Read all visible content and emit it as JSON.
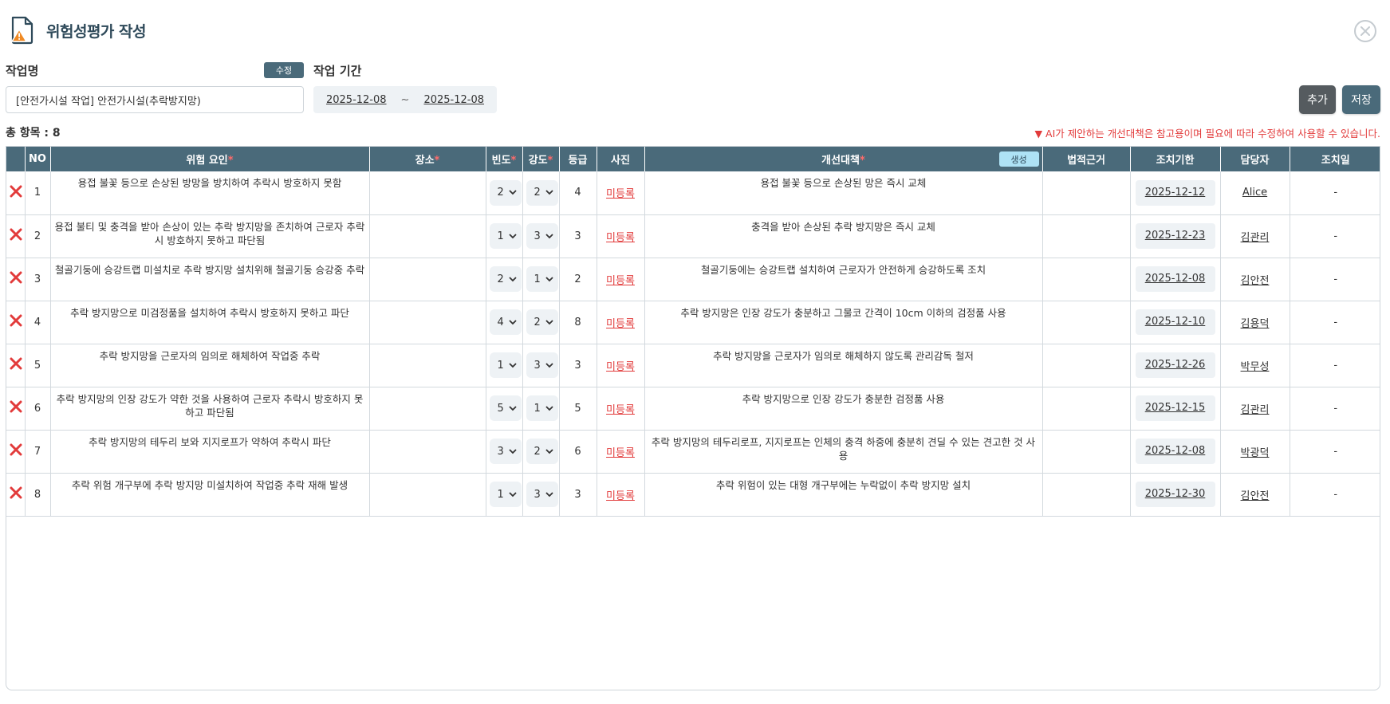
{
  "header": {
    "title": "위험성평가 작성"
  },
  "form": {
    "job_name_label": "작업명",
    "edit_label": "수정",
    "job_period_label": "작업 기간",
    "job_name_value": "[안전가시설 작업] 안전가시설(추락방지망)",
    "period_start": "2025-12-08",
    "period_sep": "~",
    "period_end": "2025-12-08"
  },
  "toolbar": {
    "add_label": "추가",
    "save_label": "저장"
  },
  "summary": {
    "total_text": "총 항목 : 8",
    "ai_note": "▼ AI가 제안하는 개선대책은 참고용이며 필요에 따라 수정하여 사용할 수 있습니다."
  },
  "table": {
    "headers": {
      "no": "NO",
      "hazard": "위험 요인",
      "place": "장소",
      "freq": "빈도",
      "severity": "강도",
      "grade": "등급",
      "photo": "사진",
      "measure": "개선대책",
      "legal": "법적근거",
      "deadline": "조치기한",
      "owner": "담당자",
      "action_date": "조치일"
    },
    "required_mark": "*",
    "generate_label": "생성",
    "rows": [
      {
        "no": "1",
        "hazard": "용접 불꽃 등으로 손상된 방망을 방치하여 추락시 방호하지 못함",
        "place": "",
        "freq": "2",
        "severity": "2",
        "grade": "4",
        "photo": "미등록",
        "measure": "용접 불꽃 등으로 손상된 망은 즉시 교체",
        "legal": "",
        "deadline": "2025-12-12",
        "owner": "Alice",
        "action_date": "-"
      },
      {
        "no": "2",
        "hazard": "용접 불티 및 충격을 받아 손상이 있는 추락 방지망을 존치하여 근로자 추락시 방호하지 못하고 파단됨",
        "place": "",
        "freq": "1",
        "severity": "3",
        "grade": "3",
        "photo": "미등록",
        "measure": "충격을 받아 손상된 추락 방지망은 즉시 교체",
        "legal": "",
        "deadline": "2025-12-23",
        "owner": "김관리",
        "action_date": "-"
      },
      {
        "no": "3",
        "hazard": "철골기둥에 승강트랩 미설치로 추락 방지망 설치위해 철골기둥 승강중 추락",
        "place": "",
        "freq": "2",
        "severity": "1",
        "grade": "2",
        "photo": "미등록",
        "measure": "철골기둥에는 승강트랩 설치하여 근로자가 안전하게 승강하도록 조치",
        "legal": "",
        "deadline": "2025-12-08",
        "owner": "김안전",
        "action_date": "-"
      },
      {
        "no": "4",
        "hazard": "추락 방지망으로 미검정품을 설치하여 추락시 방호하지 못하고 파단",
        "place": "",
        "freq": "4",
        "severity": "2",
        "grade": "8",
        "photo": "미등록",
        "measure": "추락 방지망은 인장 강도가 충분하고 그물코 간격이 10cm 이하의 검정품 사용",
        "legal": "",
        "deadline": "2025-12-10",
        "owner": "김용덕",
        "action_date": "-"
      },
      {
        "no": "5",
        "hazard": "추락 방지망을 근로자의 임의로 해체하여 작업중 추락",
        "place": "",
        "freq": "1",
        "severity": "3",
        "grade": "3",
        "photo": "미등록",
        "measure": "추락 방지망을 근로자가 임의로 해체하지 않도록 관리감독 철저",
        "legal": "",
        "deadline": "2025-12-26",
        "owner": "박무성",
        "action_date": "-"
      },
      {
        "no": "6",
        "hazard": "추락 방지망의 인장 강도가 약한 것을 사용하여 근로자 추락시 방호하지 못하고 파단됨",
        "place": "",
        "freq": "5",
        "severity": "1",
        "grade": "5",
        "photo": "미등록",
        "measure": "추락 방지망으로 인장 강도가 충분한 검정품 사용",
        "legal": "",
        "deadline": "2025-12-15",
        "owner": "김관리",
        "action_date": "-"
      },
      {
        "no": "7",
        "hazard": "추락 방지망의 테두리 보와 지지로프가 약하여 추락시 파단",
        "place": "",
        "freq": "3",
        "severity": "2",
        "grade": "6",
        "photo": "미등록",
        "measure": "추락 방지망의 테두리로프, 지지로프는 인체의 충격 하중에 충분히 견딜 수 있는 견고한 것 사용",
        "legal": "",
        "deadline": "2025-12-08",
        "owner": "박광덕",
        "action_date": "-"
      },
      {
        "no": "8",
        "hazard": "추락 위험 개구부에 추락 방지망 미설치하여 작업중 추락 재해 발생",
        "place": "",
        "freq": "1",
        "severity": "3",
        "grade": "3",
        "photo": "미등록",
        "measure": "추락 위험이 있는 대형 개구부에는 누락없이 추락 방지망 설치",
        "legal": "",
        "deadline": "2025-12-30",
        "owner": "김안전",
        "action_date": "-"
      }
    ]
  },
  "colors": {
    "header_bg": "#4a6a7a",
    "accent_red": "#e23b3b",
    "chip_bg": "#eef2f5",
    "warning_orange": "#f08a24"
  }
}
